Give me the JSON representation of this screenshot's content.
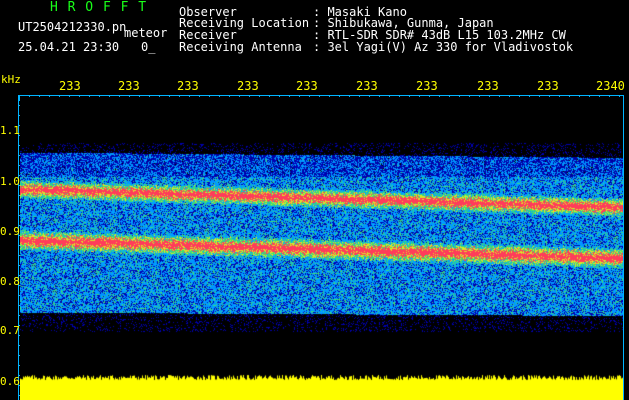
{
  "header": {
    "program": "H R O F F T",
    "filename": "UT2504212330.pn",
    "datetime": "25.04.21 23:30",
    "counter": "0_",
    "meteor_label": "meteor",
    "fields": [
      {
        "label": "Observer",
        "value": ": Masaki Kano"
      },
      {
        "label": "Receiving Location",
        "value": ": Shibukawa, Gunma, Japan"
      },
      {
        "label": "Receiver",
        "value": ": RTL-SDR SDR# 43dB L15 103.2MHz CW"
      },
      {
        "label": "Receiving Antenna",
        "value": ": 3el Yagi(V) Az 330 for Vladivostok"
      }
    ]
  },
  "axes": {
    "y_unit": "kHz",
    "y_labels": [
      "1.1",
      "1.0",
      "0.9",
      "0.8",
      "0.7",
      "0.6"
    ],
    "x_labels": [
      "233",
      "233",
      "233",
      "233",
      "233",
      "233",
      "233",
      "233",
      "233",
      "2340"
    ]
  },
  "colors": {
    "background": "#000000",
    "axis": "#00b4ff",
    "text_header": "#ffffff",
    "text_axis": "#ffff00",
    "title_green": "#19ff19",
    "power_fill": "#ffff00"
  }
}
